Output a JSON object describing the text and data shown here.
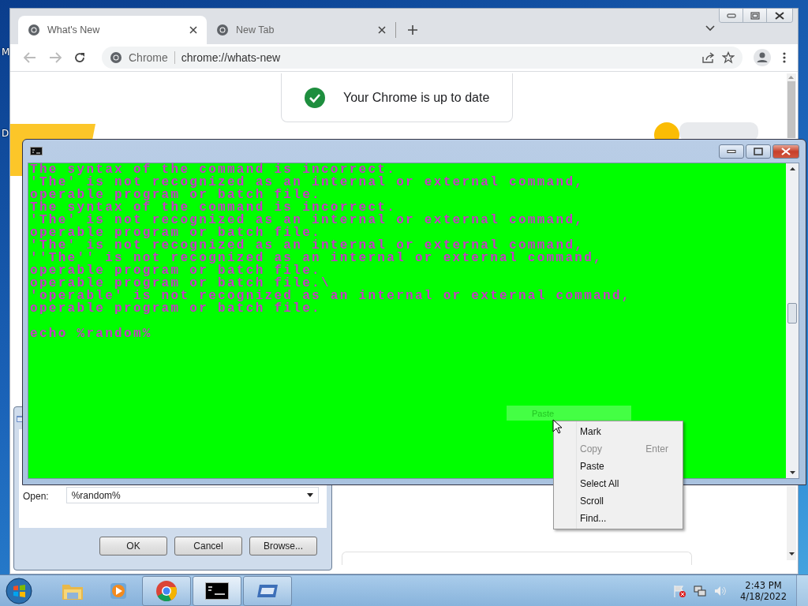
{
  "desktop": {
    "icon_labels": [
      "M",
      "D"
    ]
  },
  "browser": {
    "tabs": [
      {
        "title": "What's New",
        "selected": true
      },
      {
        "title": "New Tab",
        "selected": false
      }
    ],
    "address": {
      "site_label": "Chrome",
      "url": "chrome://whats-new"
    },
    "update_card": {
      "text": "Your Chrome is up to date"
    }
  },
  "console": {
    "lines": [
      "The syntax of the command is incorrect.",
      "'The' is not recognized as an internal or external command,",
      "operable program or batch file.",
      "The syntax of the command is incorrect.",
      "'The' is not recognized as an internal or external command,",
      "operable program or batch file.",
      "'The' is not recognized as an internal or external command,",
      "''The'' is not recognized as an internal or external command,",
      "operable program or batch file.",
      "operable program or batch file.\\",
      "'operable' is not recognized as an internal or external command,",
      "operable program or batch file."
    ],
    "prompt_line": "echo %random%",
    "paste_hint": "Paste",
    "context_menu": [
      {
        "label": "Mark",
        "disabled": false
      },
      {
        "label": "Copy",
        "shortcut": "Enter",
        "disabled": true
      },
      {
        "label": "Paste",
        "disabled": false
      },
      {
        "label": "Select All",
        "disabled": false
      },
      {
        "label": "Scroll",
        "disabled": false
      },
      {
        "label": "Find...",
        "disabled": false
      }
    ]
  },
  "run_dialog": {
    "open_label": "Open:",
    "value": "%random%",
    "buttons": [
      "OK",
      "Cancel",
      "Browse..."
    ]
  },
  "taskbar": {
    "items": [
      {
        "kind": "explorer",
        "open": false,
        "selected": false
      },
      {
        "kind": "media",
        "open": false,
        "selected": false
      },
      {
        "kind": "chrome",
        "open": true,
        "selected": false
      },
      {
        "kind": "console",
        "open": true,
        "selected": true
      },
      {
        "kind": "run",
        "open": true,
        "selected": false
      }
    ],
    "clock": {
      "time": "2:43 PM",
      "date": "4/18/2022"
    }
  }
}
